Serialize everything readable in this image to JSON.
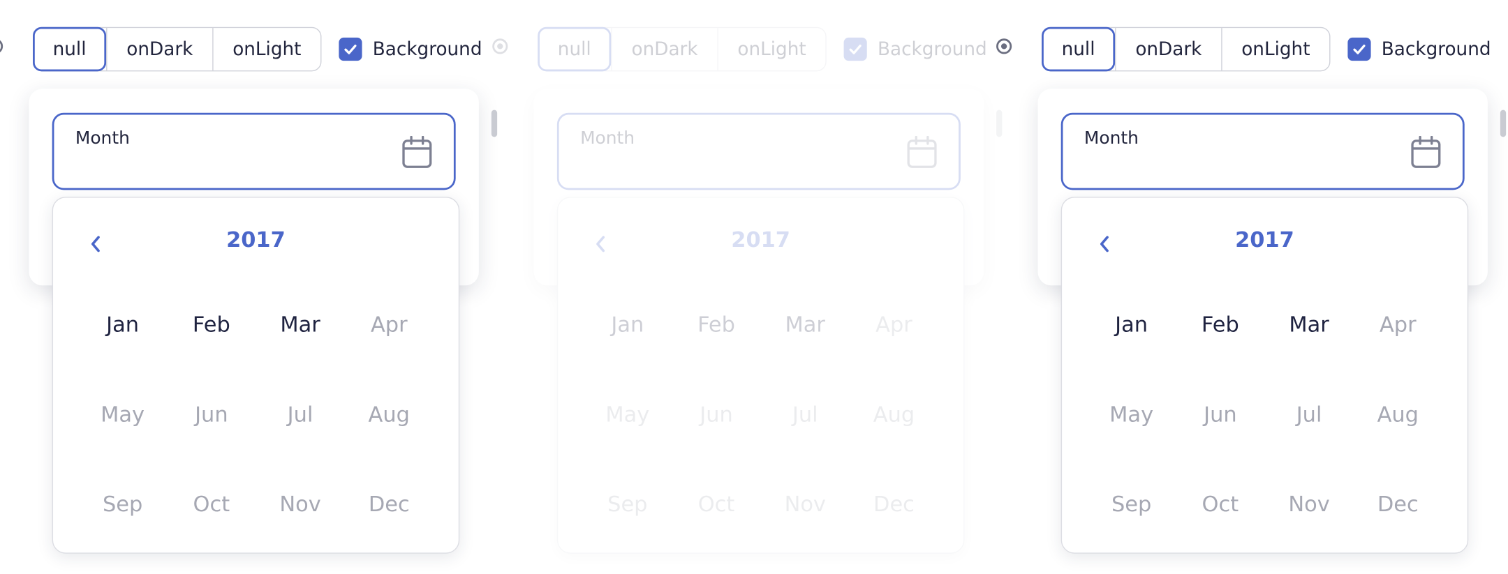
{
  "segments": [
    "null",
    "onDark",
    "onLight"
  ],
  "background_label": "Background",
  "field_label": "Month",
  "year": "2017",
  "months": [
    {
      "label": "Jan",
      "enabled": true
    },
    {
      "label": "Feb",
      "enabled": true
    },
    {
      "label": "Mar",
      "enabled": true
    },
    {
      "label": "Apr",
      "enabled": false
    },
    {
      "label": "May",
      "enabled": false
    },
    {
      "label": "Jun",
      "enabled": false
    },
    {
      "label": "Jul",
      "enabled": false
    },
    {
      "label": "Aug",
      "enabled": false
    },
    {
      "label": "Sep",
      "enabled": false
    },
    {
      "label": "Oct",
      "enabled": false
    },
    {
      "label": "Nov",
      "enabled": false
    },
    {
      "label": "Dec",
      "enabled": false
    }
  ],
  "panels": [
    {
      "id": "left",
      "faded": false
    },
    {
      "id": "middle",
      "faded": true
    },
    {
      "id": "right",
      "faded": false
    }
  ],
  "colors": {
    "accent": "#4a66c9",
    "text": "#1f2340",
    "muted": "#a6a8b3",
    "border": "#cfd1d9"
  },
  "icons": {
    "field": "calendar-icon",
    "prev": "chevron-left-icon",
    "checkbox": "checkmark-icon"
  }
}
